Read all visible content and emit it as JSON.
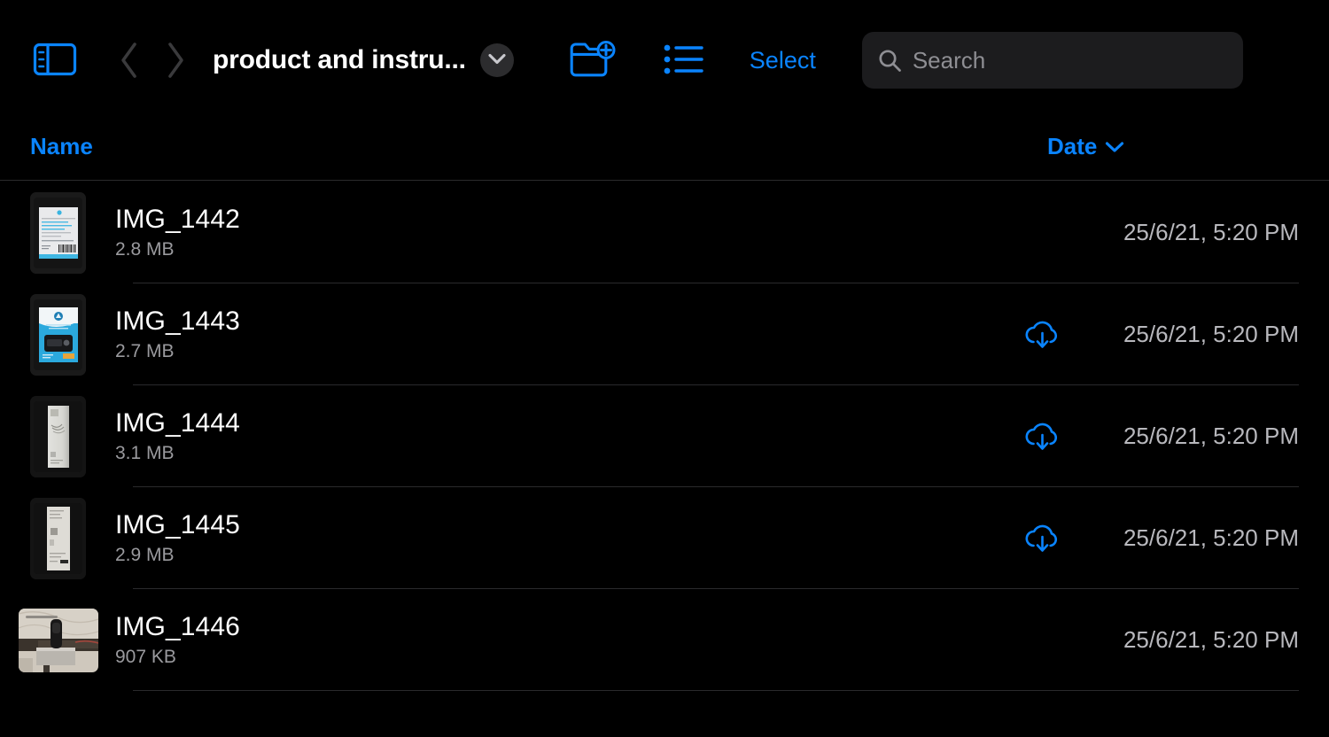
{
  "window": {
    "background_color": "#000000",
    "accent_color": "#0a84ff"
  },
  "toolbar": {
    "sidebar_toggle_icon": "sidebar-toggle-icon",
    "back_icon": "chevron-left-icon",
    "forward_icon": "chevron-right-icon",
    "folder_title": "product and instru...",
    "title_menu_icon": "chevron-down-icon",
    "new_folder_icon": "folder-plus-icon",
    "list_view_icon": "bulleted-list-icon",
    "select_label": "Select",
    "search": {
      "icon": "search-icon",
      "placeholder": "Search",
      "value": ""
    }
  },
  "columns": {
    "name_label": "Name",
    "date_label": "Date",
    "sort_icon": "chevron-down-icon",
    "sorted_by": "Date"
  },
  "files": [
    {
      "name": "IMG_1442",
      "size": "2.8 MB",
      "date": "25/6/21, 5:20 PM",
      "cloud_status": "downloaded",
      "thumbnail": "document-label-barcode"
    },
    {
      "name": "IMG_1443",
      "size": "2.7 MB",
      "date": "25/6/21, 5:20 PM",
      "cloud_status": "not-downloaded",
      "thumbnail": "blue-product-packaging"
    },
    {
      "name": "IMG_1444",
      "size": "3.1 MB",
      "date": "25/6/21, 5:20 PM",
      "cloud_status": "not-downloaded",
      "thumbnail": "white-instruction-sheet"
    },
    {
      "name": "IMG_1445",
      "size": "2.9 MB",
      "date": "25/6/21, 5:20 PM",
      "cloud_status": "not-downloaded",
      "thumbnail": "white-document-page"
    },
    {
      "name": "IMG_1446",
      "size": "907 KB",
      "date": "25/6/21, 5:20 PM",
      "cloud_status": "downloaded",
      "thumbnail": "desk-device-photo"
    }
  ]
}
